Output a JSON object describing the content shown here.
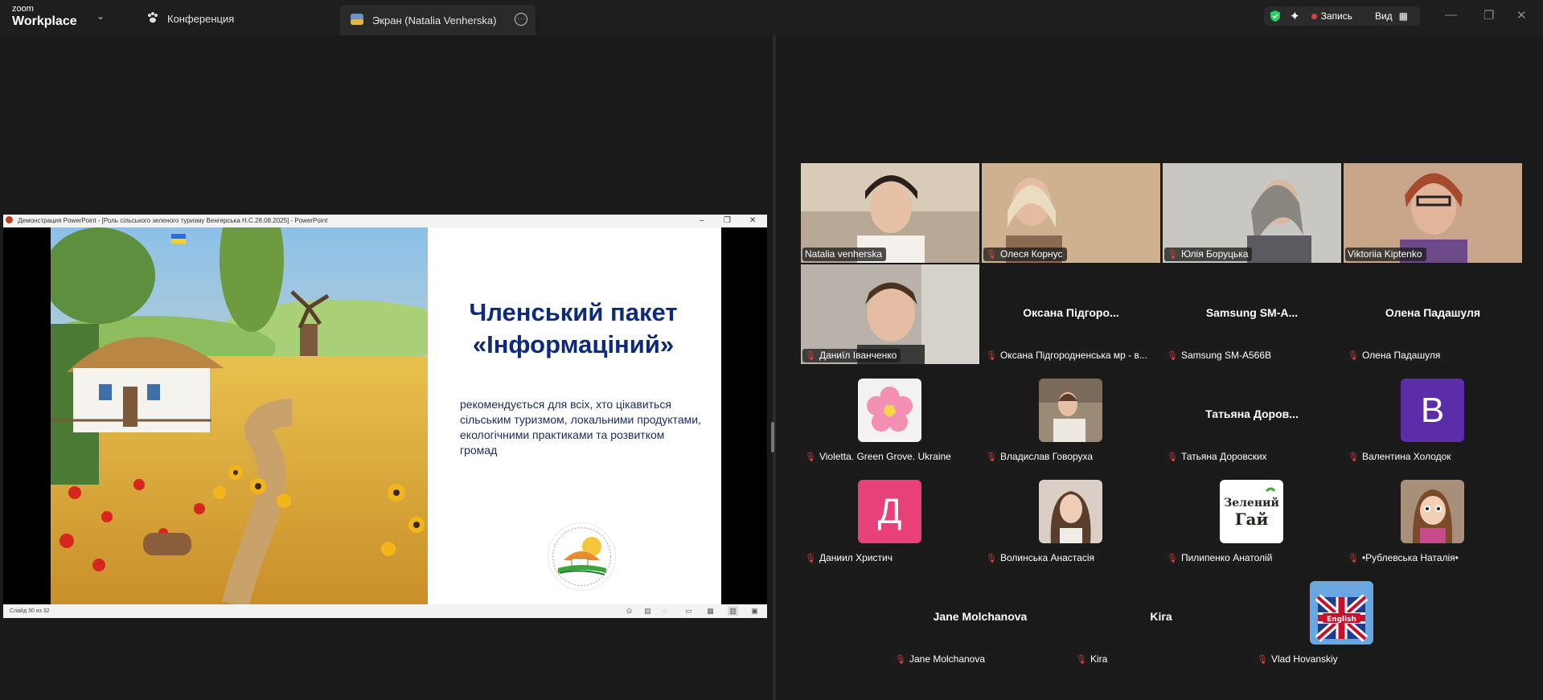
{
  "app": {
    "brand_line1": "zoom",
    "brand_line2": "Workplace"
  },
  "tabs": {
    "conference": "Конференция",
    "screen": "Экран (Natalia Venherska)"
  },
  "topright": {
    "record_label": "Запись",
    "view_label": "Вид"
  },
  "ppt": {
    "title": "Демонстрация PowerPoint - [Роль сільського зеленого  туризму  Венгерська Н.С.28.08.2025] - PowerPoint",
    "status": "Слайд 30 из 32",
    "slide_title": "Членський пакет «Інформаціний»",
    "slide_body": "рекомендується для всіх, хто цікавиться сільським туризмом, локальними продуктами, екологічними практиками та розвитком громад"
  },
  "participants": [
    {
      "name": "Natalia venherska",
      "kind": "video",
      "active": true,
      "muted": false
    },
    {
      "name": "Олеся Корнус",
      "kind": "video",
      "muted": true
    },
    {
      "name": "Юлія Боруцька",
      "kind": "video",
      "muted": true
    },
    {
      "name": "Viktoriia Kiptenko",
      "kind": "video",
      "muted": false
    },
    {
      "name": "Даниїл Іванченко",
      "kind": "video",
      "muted": true
    },
    {
      "name": "Оксана Підгородненська мр - в...",
      "display": "Оксана  Підгоро...",
      "kind": "name",
      "muted": true
    },
    {
      "name": "Samsung SM-A566B",
      "display": "Samsung  SM-A...",
      "kind": "name",
      "muted": true
    },
    {
      "name": "Олена Падашуля",
      "display": "Олена Падашуля",
      "kind": "name",
      "muted": true
    },
    {
      "name": "Violetta. Green Grove. Ukraine",
      "kind": "avatar",
      "avatar": "flower",
      "muted": true
    },
    {
      "name": "Владислав Говоруха",
      "kind": "avatar",
      "avatar": "photo-boy",
      "muted": true
    },
    {
      "name": "Татьяна Доровских",
      "display": "Татьяна  Доров...",
      "kind": "name",
      "muted": true
    },
    {
      "name": "Валентина Холодок",
      "kind": "avatar",
      "avatar": "letter",
      "letter": "B",
      "color": "#5b2da8",
      "muted": true
    },
    {
      "name": "Даниил Христич",
      "kind": "avatar",
      "avatar": "letter",
      "letter": "Д",
      "color": "#e8417a",
      "muted": true
    },
    {
      "name": "Волинська Анастасія",
      "kind": "avatar",
      "avatar": "photo-girl",
      "muted": true
    },
    {
      "name": "Пилипенко Анатолій",
      "kind": "avatar",
      "avatar": "green-logo",
      "muted": true
    },
    {
      "name": "•Рублевська Наталія•",
      "kind": "avatar",
      "avatar": "cartoon",
      "muted": true
    },
    {
      "name": "Jane Molchanova",
      "display": "Jane Molchanova",
      "kind": "name",
      "muted": true
    },
    {
      "name": "Kira",
      "display": "Kira",
      "kind": "name",
      "muted": true
    },
    {
      "name": "Vlad Hovanskiy",
      "kind": "avatar",
      "avatar": "uk-flag",
      "muted": true
    }
  ],
  "logo_text": {
    "green": "Зелений",
    "gai": "Гай",
    "english": "English"
  },
  "colors": {
    "active_border": "#23d160",
    "mute": "#e0403a",
    "slide_title": "#0e2a7a"
  }
}
